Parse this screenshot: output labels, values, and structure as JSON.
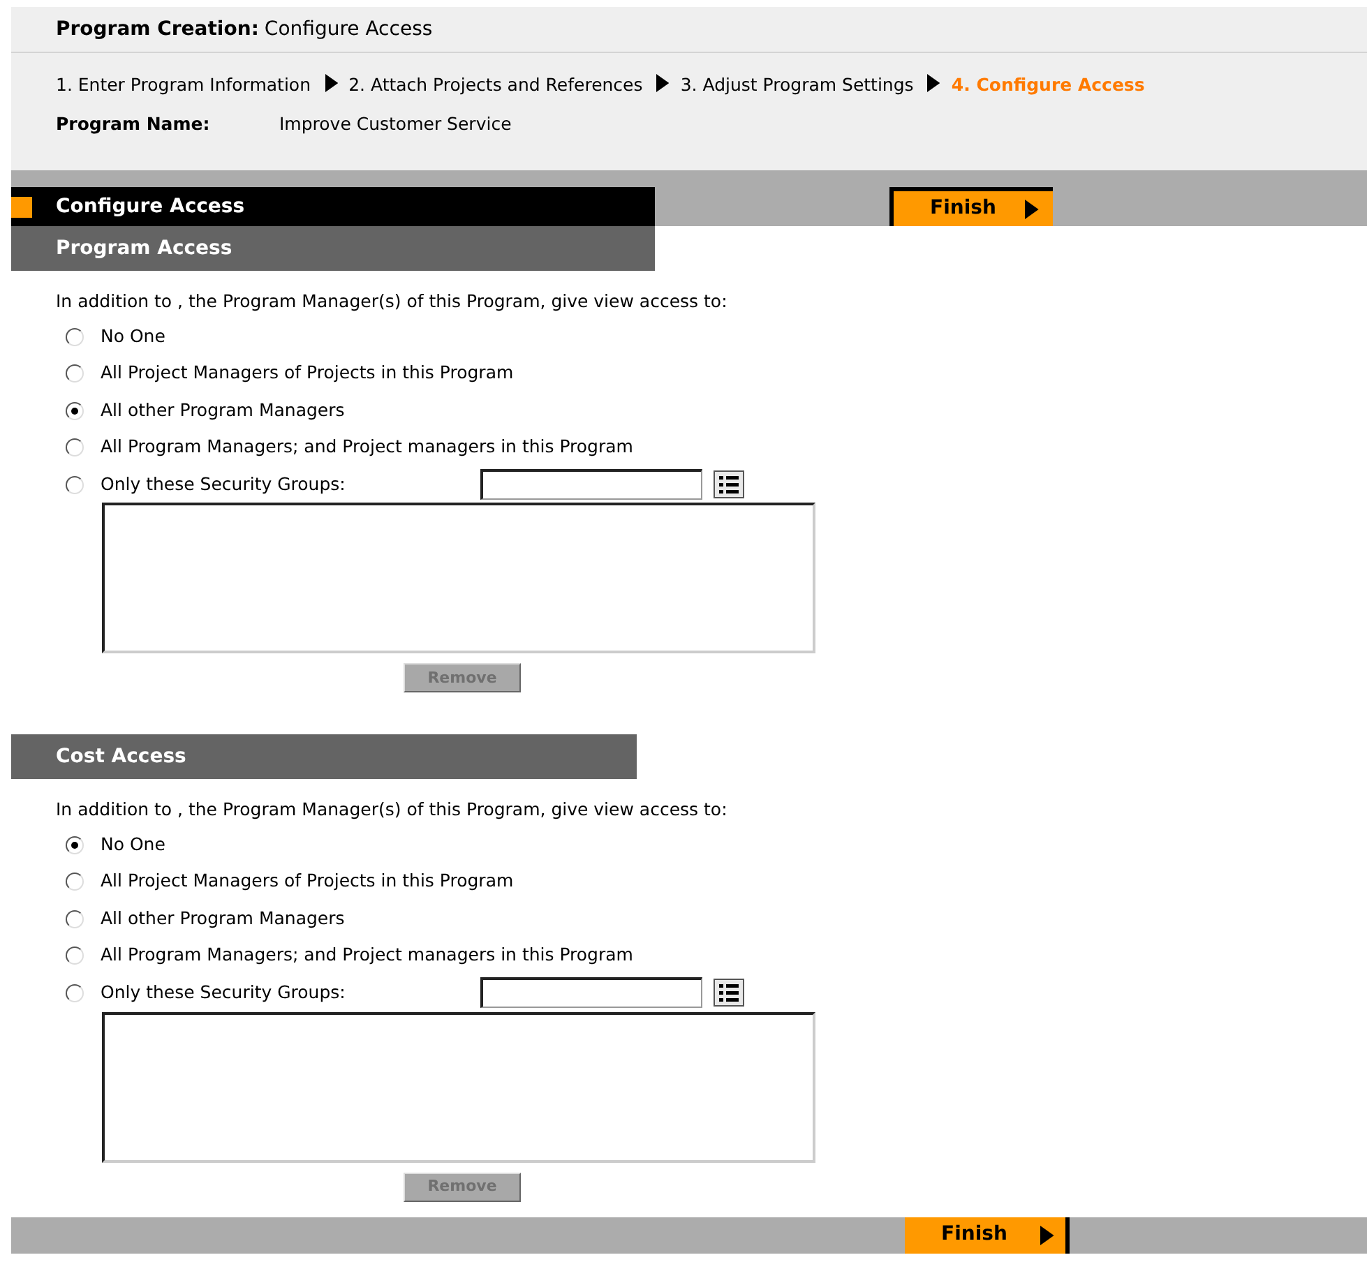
{
  "header": {
    "title_label": "Program Creation:",
    "title_value": "Configure Access"
  },
  "steps": [
    {
      "label": "1. Enter Program Information",
      "selected": false
    },
    {
      "label": "2. Attach Projects and References",
      "selected": false
    },
    {
      "label": "3. Adjust Program Settings",
      "selected": false
    },
    {
      "label": "4. Configure Access",
      "selected": true
    }
  ],
  "program_name": {
    "label": "Program Name:",
    "value": "Improve Customer Service"
  },
  "toolbar": {
    "title": "Configure Access",
    "finish": "Finish"
  },
  "sections": [
    {
      "title": "Program Access",
      "intro": "In addition to , the Program Manager(s) of this Program, give view access to:",
      "options": [
        {
          "label": "No One",
          "selected": false
        },
        {
          "label": "All Project Managers of Projects in this Program",
          "selected": false
        },
        {
          "label": "All other Program Managers",
          "selected": true
        },
        {
          "label": "All Program Managers; and Project managers in this Program",
          "selected": false
        },
        {
          "label": "Only these Security Groups:",
          "selected": false,
          "kind": "groups"
        }
      ],
      "remove": {
        "label": "Remove",
        "disabled": true
      }
    },
    {
      "title": "Cost Access",
      "intro": "In addition to , the Program Manager(s) of this Program, give view access to:",
      "options": [
        {
          "label": "No One",
          "selected": true
        },
        {
          "label": "All Project Managers of Projects in this Program",
          "selected": false
        },
        {
          "label": "All other Program Managers",
          "selected": false
        },
        {
          "label": "All Program Managers; and Project managers in this Program",
          "selected": false
        },
        {
          "label": "Only these Security Groups:",
          "selected": false,
          "kind": "groups"
        }
      ],
      "remove": {
        "label": "Remove",
        "disabled": true
      }
    }
  ],
  "footer": {
    "finish": "Finish"
  }
}
